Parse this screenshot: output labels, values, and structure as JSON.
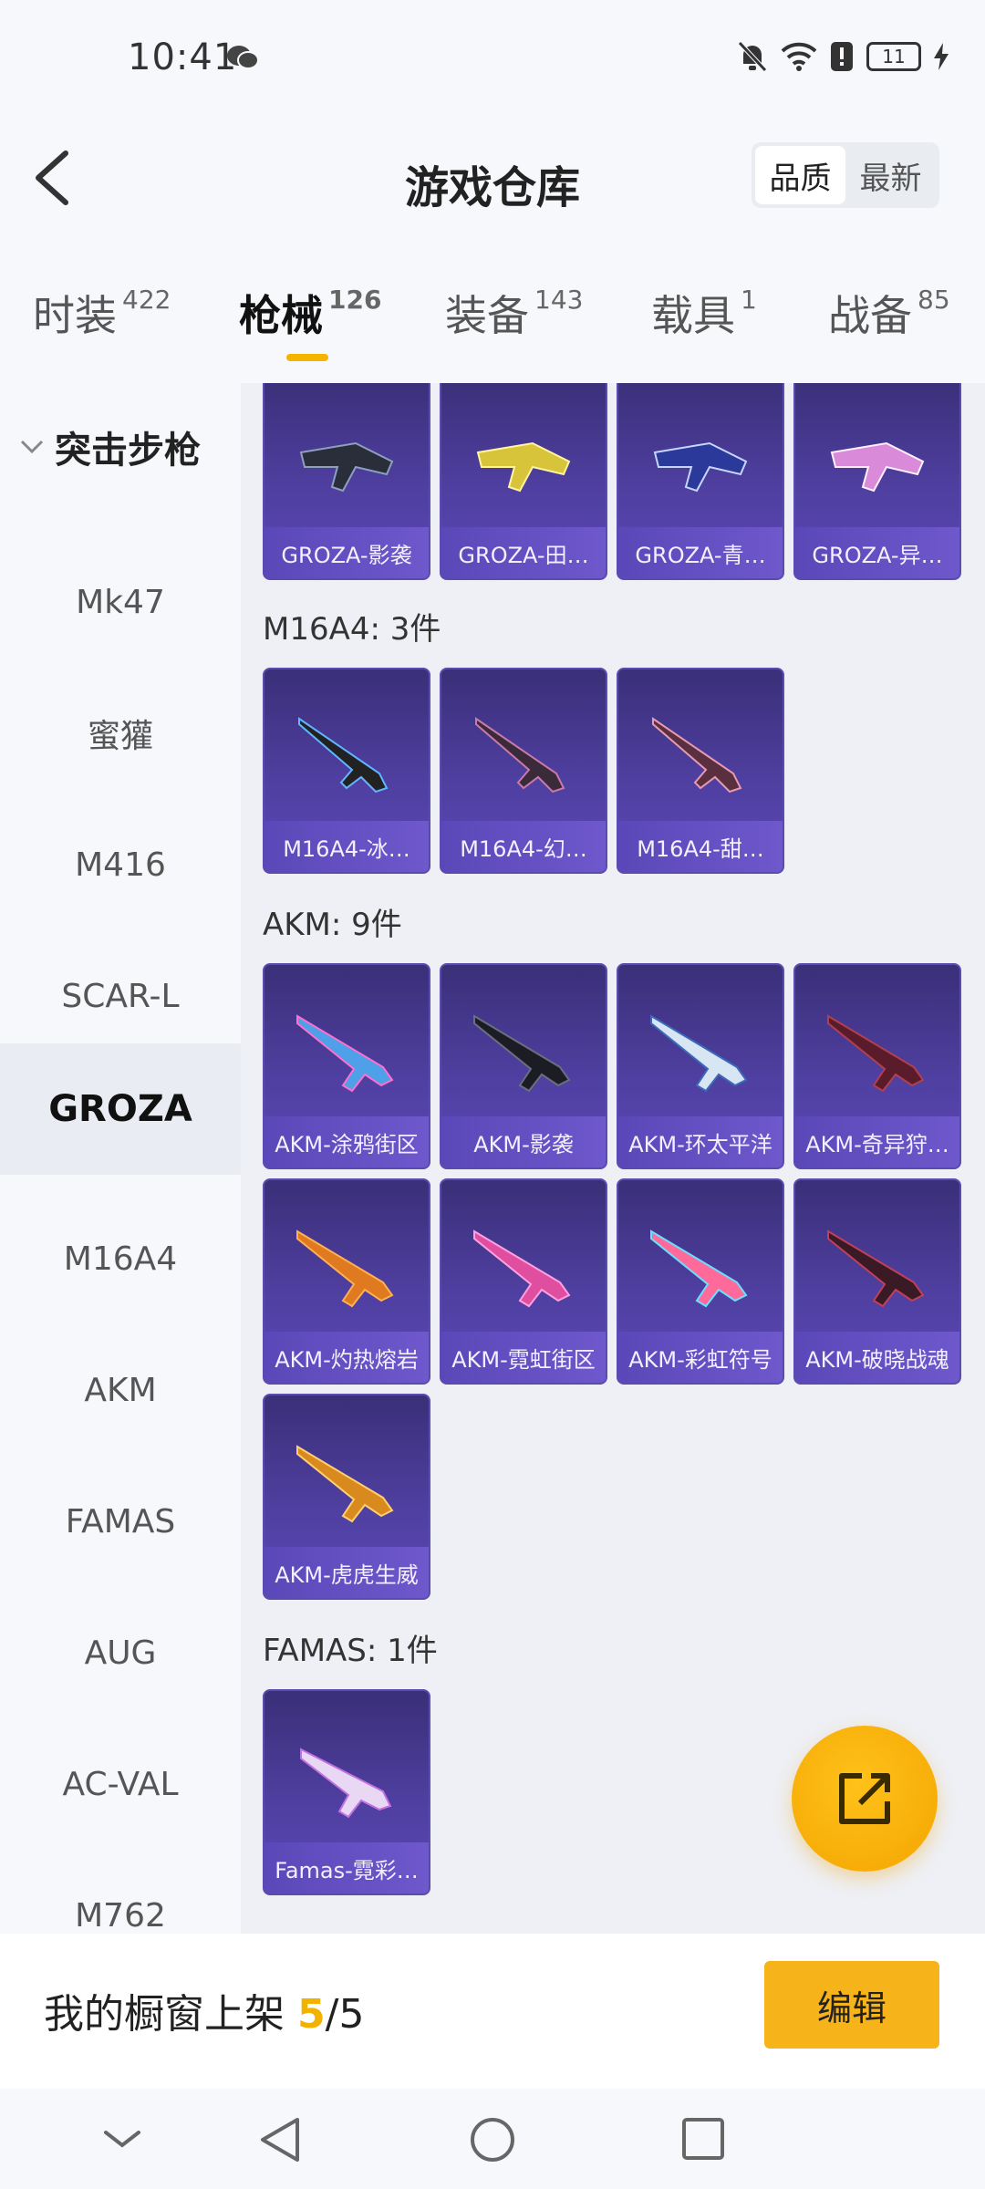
{
  "status": {
    "time": "10:41",
    "battery": "11"
  },
  "header": {
    "title": "游戏仓库",
    "sort_options": [
      "品质",
      "最新"
    ],
    "selected_sort": "品质"
  },
  "tabs": [
    {
      "label": "时装",
      "count": "422"
    },
    {
      "label": "枪械",
      "count": "126",
      "active": true
    },
    {
      "label": "装备",
      "count": "143"
    },
    {
      "label": "载具",
      "count": "1"
    },
    {
      "label": "战备",
      "count": "85"
    }
  ],
  "sidebar": {
    "group": "突击步枪",
    "items": [
      "Mk47",
      "蜜獾",
      "M416",
      "SCAR-L",
      "GROZA",
      "M16A4",
      "AKM",
      "FAMAS",
      "AUG",
      "AC-VAL",
      "M762"
    ],
    "selected": "GROZA"
  },
  "sections": [
    {
      "title": "",
      "items": [
        "GROZA-影袭",
        "GROZA-田…",
        "GROZA-青…",
        "GROZA-异…"
      ]
    },
    {
      "title": "M16A4: 3件",
      "items": [
        "M16A4-冰…",
        "M16A4-幻…",
        "M16A4-甜…"
      ]
    },
    {
      "title": "AKM: 9件",
      "items": [
        "AKM-涂鸦街区",
        "AKM-影袭",
        "AKM-环太平洋",
        "AKM-奇异狩…",
        "AKM-灼热熔岩",
        "AKM-霓虹街区",
        "AKM-彩虹符号",
        "AKM-破晓战魂",
        "AKM-虎虎生威"
      ]
    },
    {
      "title": "FAMAS: 1件",
      "items": [
        "Famas-霓彩…"
      ]
    }
  ],
  "bottom": {
    "label": "我的橱窗上架",
    "count": "5",
    "total": "/5",
    "edit_button": "编辑"
  },
  "colors": {
    "accent": "#f7b31a",
    "card": "#4f3fa0"
  }
}
